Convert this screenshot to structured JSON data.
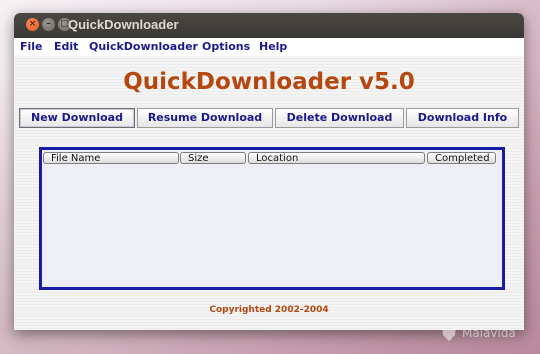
{
  "window": {
    "title": "QuickDownloader"
  },
  "menu": [
    {
      "label": "File"
    },
    {
      "label": "Edit"
    },
    {
      "label": "QuickDownloader"
    },
    {
      "label": "Options"
    },
    {
      "label": "Help"
    }
  ],
  "app": {
    "heading": "QuickDownloader v5.0",
    "copyright": "Copyrighted 2002-2004"
  },
  "toolbar": {
    "new_download": "New Download",
    "resume_download": "Resume Download",
    "delete_download": "Delete Download",
    "download_info": "Download Info"
  },
  "table": {
    "columns": [
      {
        "label": "File Name"
      },
      {
        "label": "Size"
      },
      {
        "label": "Location"
      },
      {
        "label": "Completed"
      }
    ],
    "rows": []
  },
  "watermark": {
    "text": "Malavida"
  },
  "colors": {
    "accent_title": "#b5470f",
    "menu_text": "#1a1a8c",
    "table_border": "#1a1aa8"
  }
}
